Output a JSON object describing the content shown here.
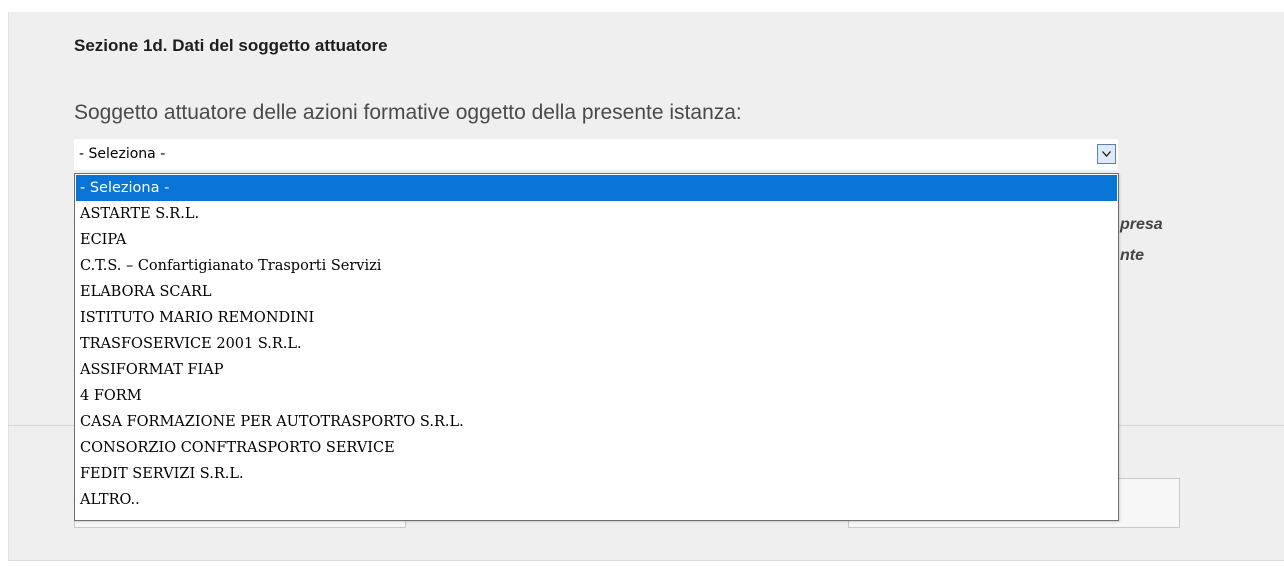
{
  "section": {
    "title": "Sezione 1d. Dati del soggetto attuatore"
  },
  "field": {
    "label": "Soggetto attuatore delle azioni formative oggetto della presente istanza:",
    "selected_value": "- Seleziona -",
    "options": [
      "- Seleziona -",
      "ASTARTE S.R.L.",
      "ECIPA",
      "C.T.S. – Confartigianato Trasporti Servizi",
      "ELABORA SCARL",
      "ISTITUTO MARIO REMONDINI",
      "TRASFOSERVICE 2001 S.R.L.",
      "ASSIFORMAT FIAP",
      "4 FORM",
      "CASA FORMAZIONE PER AUTOTRASPORTO S.R.L.",
      "CONSORZIO CONFTRASPORTO SERVICE",
      "FEDIT SERVIZI S.R.L.",
      "ALTRO.."
    ],
    "highlighted_index": 0
  },
  "background": {
    "partial_text_1": "presa",
    "partial_text_2": "nte"
  },
  "icons": {
    "dropdown_arrow": "chevron-down-icon"
  },
  "colors": {
    "highlight": "#0a73d6",
    "panel_bg": "#f0efef"
  }
}
